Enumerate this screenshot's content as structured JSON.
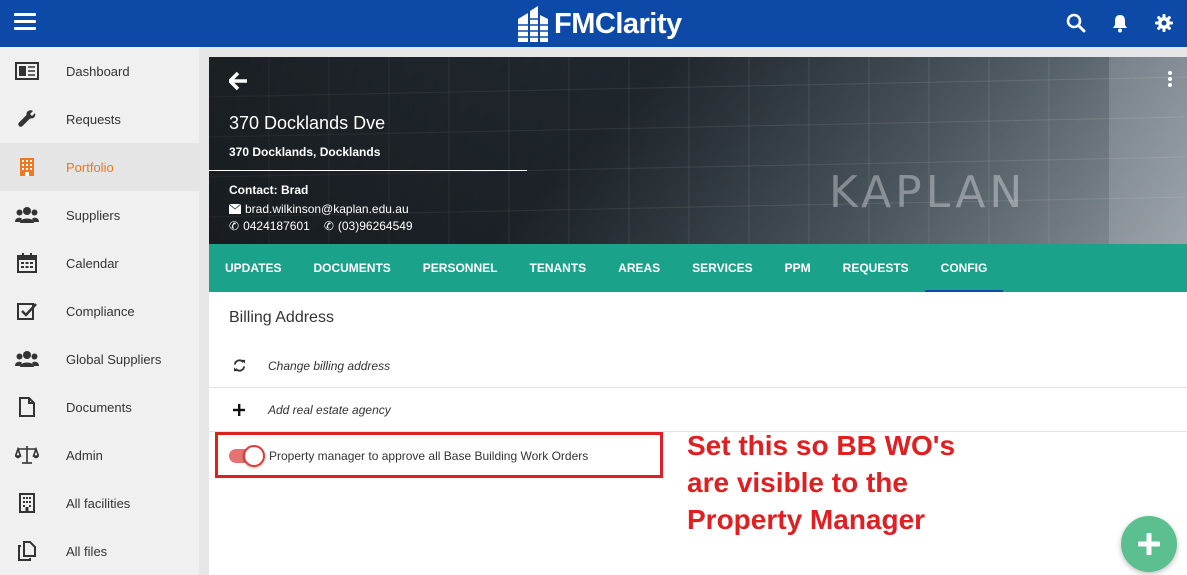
{
  "app": {
    "brand_name": "FMClarity",
    "accent_color": "#0d4aa8",
    "tab_color": "#1aa38a",
    "active_color": "#f0761f"
  },
  "sidebar": {
    "items": [
      {
        "label": "Dashboard",
        "icon": "dashboard-icon"
      },
      {
        "label": "Requests",
        "icon": "wrench-icon"
      },
      {
        "label": "Portfolio",
        "icon": "building-icon",
        "active": true
      },
      {
        "label": "Suppliers",
        "icon": "users-icon"
      },
      {
        "label": "Calendar",
        "icon": "calendar-icon"
      },
      {
        "label": "Compliance",
        "icon": "checkbox-icon"
      },
      {
        "label": "Global Suppliers",
        "icon": "users-icon"
      },
      {
        "label": "Documents",
        "icon": "document-icon"
      },
      {
        "label": "Admin",
        "icon": "scales-icon"
      },
      {
        "label": "All facilities",
        "icon": "building-icon"
      },
      {
        "label": "All files",
        "icon": "files-icon"
      }
    ]
  },
  "header": {
    "title": "370 Docklands Dve",
    "address": "370 Docklands, Docklands",
    "contact_label": "Contact: Brad",
    "email": "brad.wilkinson@kaplan.edu.au",
    "phone1": "0424187601",
    "phone2": "(03)96264549",
    "background_sign": "KAPLAN"
  },
  "tabs": [
    {
      "label": "UPDATES"
    },
    {
      "label": "DOCUMENTS"
    },
    {
      "label": "PERSONNEL"
    },
    {
      "label": "TENANTS"
    },
    {
      "label": "AREAS"
    },
    {
      "label": "SERVICES"
    },
    {
      "label": "PPM"
    },
    {
      "label": "REQUESTS"
    },
    {
      "label": "CONFIG",
      "active": true
    }
  ],
  "config": {
    "section_title": "Billing Address",
    "change_billing_label": "Change billing address",
    "add_agency_label": "Add real estate agency",
    "toggle_label": "Property manager to approve all Base Building Work Orders",
    "toggle_on": true
  },
  "annotation": {
    "text": "Set this so BB WO's are visible to the Property Manager"
  }
}
